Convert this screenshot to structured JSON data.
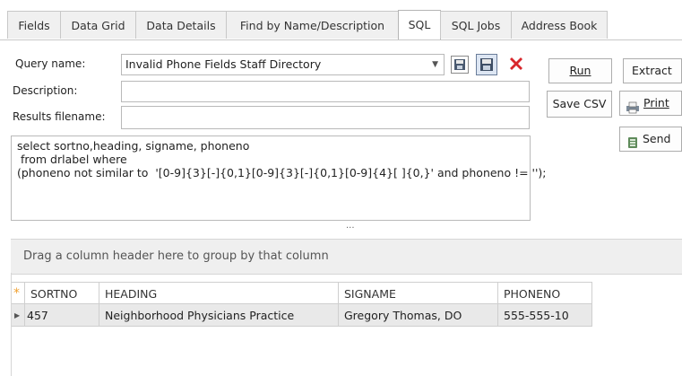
{
  "tabs": [
    "Fields",
    "Data Grid",
    "Data Details",
    "Find by Name/Description",
    "SQL",
    "SQL Jobs",
    "Address Book"
  ],
  "form": {
    "query_name_label": "Query name:",
    "query_name_value": "Invalid Phone Fields Staff Directory",
    "description_label": "Description:",
    "description_value": "",
    "results_label": "Results filename:",
    "results_value": ""
  },
  "buttons": {
    "run": "Run",
    "extract": "Extract",
    "save_csv": "Save CSV",
    "print": "Print",
    "send": "Send"
  },
  "sql_lines": [
    "select sortno,heading, signame, phoneno",
    " from drlabel where",
    "(phoneno not similar to  '[0-9]{3}[-]{0,1}[0-9]{3}[-]{0,1}[0-9]{4}[ ]{0,}' and phoneno != '');"
  ],
  "splitter_glyph": "...",
  "grid": {
    "group_hint": "Drag a column header here to group by that column",
    "columns": [
      "SORTNO",
      "HEADING",
      "SIGNAME",
      "PHONENO"
    ],
    "rows": [
      [
        "457",
        "Neighborhood Physicians Practice",
        "Gregory Thomas, DO",
        "555-555-10"
      ]
    ]
  },
  "colors": {
    "tab_bg": "#f0f0f0",
    "accent_orange": "#f0a030",
    "delete_red": "#d8262b",
    "row_bg": "#e9e9e9"
  },
  "icons": [
    "dropdown-arrow-icon",
    "save-disk-icon",
    "save-as-icon",
    "delete-x-icon",
    "printer-icon",
    "send-icon",
    "row-pointer-icon",
    "new-row-star-icon"
  ]
}
